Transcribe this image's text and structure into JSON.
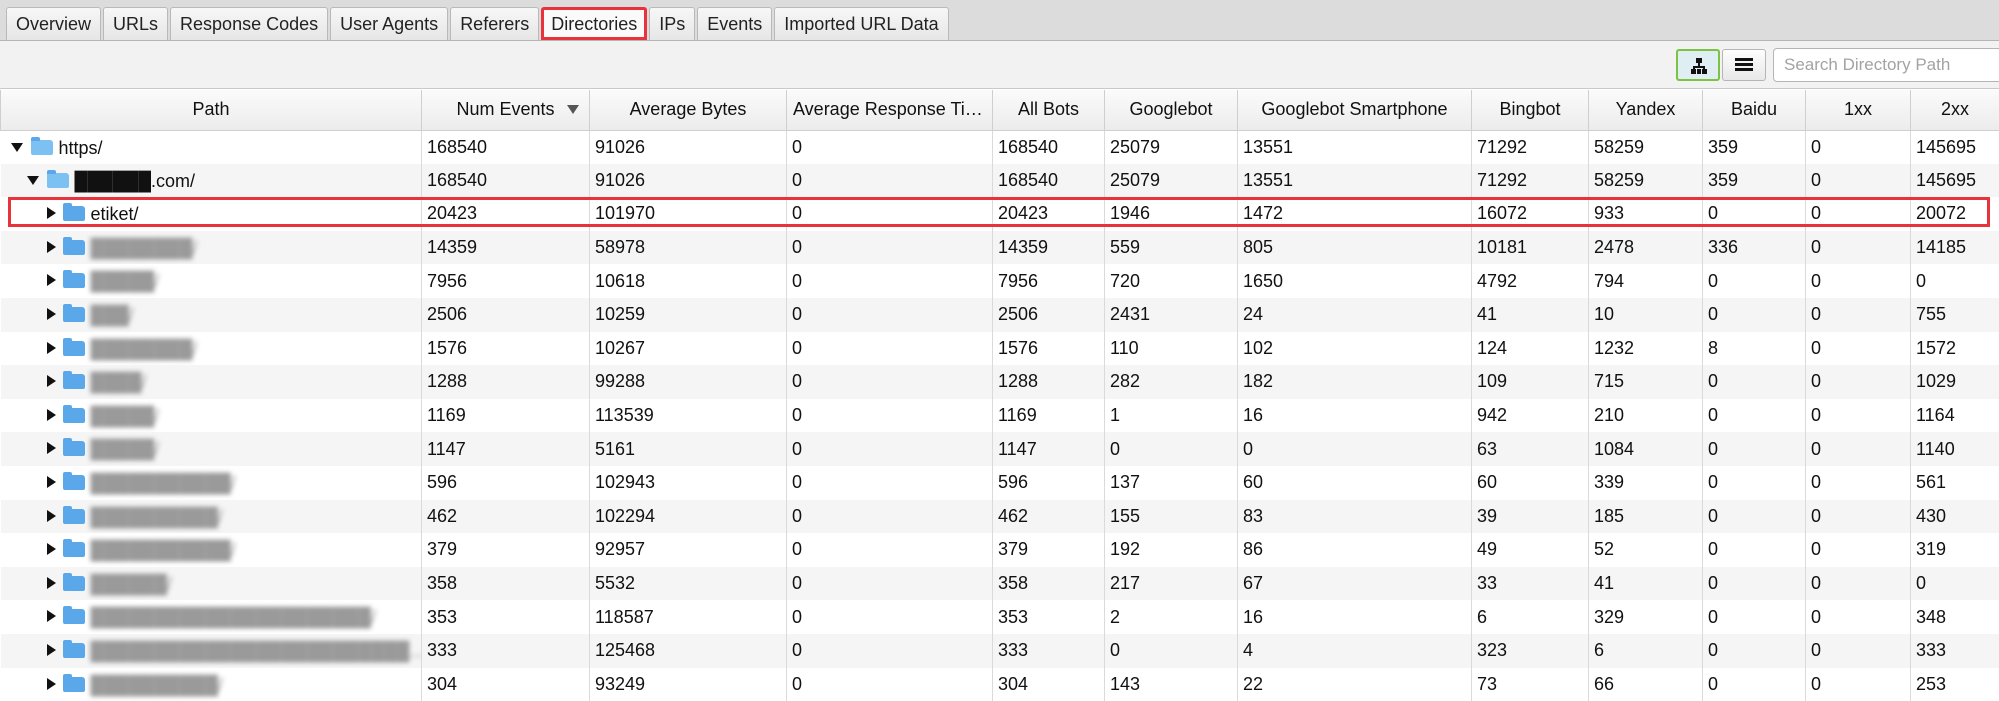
{
  "tabs": [
    "Overview",
    "URLs",
    "Response Codes",
    "User Agents",
    "Referers",
    "Directories",
    "IPs",
    "Events",
    "Imported URL Data"
  ],
  "active_tab": "Directories",
  "search": {
    "placeholder": "Search Directory Path"
  },
  "columns": [
    "Path",
    "Num Events",
    "Average Bytes",
    "Average Response Tim...",
    "All Bots",
    "Googlebot",
    "Googlebot Smartphone",
    "Bingbot",
    "Yandex",
    "Baidu",
    "1xx",
    "2xx"
  ],
  "rows": [
    {
      "path": "https/",
      "level": 0,
      "expanded": true,
      "blurred": false,
      "values": [
        "168540",
        "91026",
        "0",
        "168540",
        "25079",
        "13551",
        "71292",
        "58259",
        "359",
        "0",
        "145695"
      ]
    },
    {
      "path": "██████.com/",
      "level": 1,
      "expanded": true,
      "blurred": false,
      "values": [
        "168540",
        "91026",
        "0",
        "168540",
        "25079",
        "13551",
        "71292",
        "58259",
        "359",
        "0",
        "145695"
      ]
    },
    {
      "path": "etiket/",
      "level": 2,
      "expanded": false,
      "blurred": false,
      "values": [
        "20423",
        "101970",
        "0",
        "20423",
        "1946",
        "1472",
        "16072",
        "933",
        "0",
        "0",
        "20072"
      ]
    },
    {
      "path": "████████/",
      "level": 2,
      "expanded": false,
      "blurred": true,
      "values": [
        "14359",
        "58978",
        "0",
        "14359",
        "559",
        "805",
        "10181",
        "2478",
        "336",
        "0",
        "14185"
      ]
    },
    {
      "path": "█████/",
      "level": 2,
      "expanded": false,
      "blurred": true,
      "values": [
        "7956",
        "10618",
        "0",
        "7956",
        "720",
        "1650",
        "4792",
        "794",
        "0",
        "0",
        "0"
      ]
    },
    {
      "path": "███/",
      "level": 2,
      "expanded": false,
      "blurred": true,
      "values": [
        "2506",
        "10259",
        "0",
        "2506",
        "2431",
        "24",
        "41",
        "10",
        "0",
        "0",
        "755"
      ]
    },
    {
      "path": "████████/",
      "level": 2,
      "expanded": false,
      "blurred": true,
      "values": [
        "1576",
        "10267",
        "0",
        "1576",
        "110",
        "102",
        "124",
        "1232",
        "8",
        "0",
        "1572"
      ]
    },
    {
      "path": "████/",
      "level": 2,
      "expanded": false,
      "blurred": true,
      "values": [
        "1288",
        "99288",
        "0",
        "1288",
        "282",
        "182",
        "109",
        "715",
        "0",
        "0",
        "1029"
      ]
    },
    {
      "path": "█████/",
      "level": 2,
      "expanded": false,
      "blurred": true,
      "values": [
        "1169",
        "113539",
        "0",
        "1169",
        "1",
        "16",
        "942",
        "210",
        "0",
        "0",
        "1164"
      ]
    },
    {
      "path": "█████/",
      "level": 2,
      "expanded": false,
      "blurred": true,
      "values": [
        "1147",
        "5161",
        "0",
        "1147",
        "0",
        "0",
        "63",
        "1084",
        "0",
        "0",
        "1140"
      ]
    },
    {
      "path": "███████████/",
      "level": 2,
      "expanded": false,
      "blurred": true,
      "values": [
        "596",
        "102943",
        "0",
        "596",
        "137",
        "60",
        "60",
        "339",
        "0",
        "0",
        "561"
      ]
    },
    {
      "path": "██████████/",
      "level": 2,
      "expanded": false,
      "blurred": true,
      "values": [
        "462",
        "102294",
        "0",
        "462",
        "155",
        "83",
        "39",
        "185",
        "0",
        "0",
        "430"
      ]
    },
    {
      "path": "███████████/",
      "level": 2,
      "expanded": false,
      "blurred": true,
      "values": [
        "379",
        "92957",
        "0",
        "379",
        "192",
        "86",
        "49",
        "52",
        "0",
        "0",
        "319"
      ]
    },
    {
      "path": "██████/",
      "level": 2,
      "expanded": false,
      "blurred": true,
      "values": [
        "358",
        "5532",
        "0",
        "358",
        "217",
        "67",
        "33",
        "41",
        "0",
        "0",
        "0"
      ]
    },
    {
      "path": "██████████████████████/",
      "level": 2,
      "expanded": false,
      "blurred": true,
      "values": [
        "353",
        "118587",
        "0",
        "353",
        "2",
        "16",
        "6",
        "329",
        "0",
        "0",
        "348"
      ]
    },
    {
      "path": "█████████████████████████...",
      "level": 2,
      "expanded": false,
      "blurred": true,
      "values": [
        "333",
        "125468",
        "0",
        "333",
        "0",
        "4",
        "323",
        "6",
        "0",
        "0",
        "333"
      ]
    },
    {
      "path": "██████████/",
      "level": 2,
      "expanded": false,
      "blurred": true,
      "values": [
        "304",
        "93249",
        "0",
        "304",
        "143",
        "22",
        "73",
        "66",
        "0",
        "0",
        "253"
      ]
    }
  ]
}
